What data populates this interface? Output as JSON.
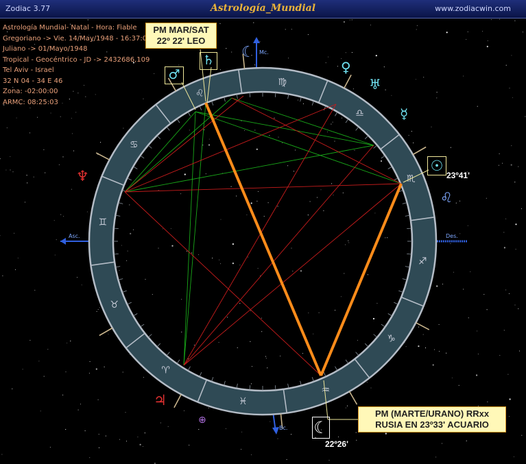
{
  "window": {
    "app_name": "Zodiac 3.77",
    "title": "Astrología_Mundial",
    "url": "www.zodiacwin.com"
  },
  "info_lines": [
    "Astrología Mundial- Natal - Hora: Fiable",
    "Gregoriano -> Vie. 14/May/1948 - 16:37:00",
    "Juliano -> 01/Mayo/1948",
    "Tropical - Geocéntrico - JD -> 2432686,109",
    "Tel Aviv - Israel",
    "32 N 04 - 34 E 46",
    "Zona: -02:00:00",
    "ARMC: 08:25:03"
  ],
  "callouts": {
    "top_line1": "PM MAR/SAT",
    "top_line2": "22º 22' LEO",
    "bottom_line1": "PM (MARTE/URANO) RRxx",
    "bottom_line2": "RUSIA EN 23º33' ACUARIO"
  },
  "labels": {
    "sun_degree": "23º41'",
    "moon_degree": "22º26'",
    "asc": "Asc.",
    "des": "Des.",
    "mc": "Mc.",
    "bc": "Bc."
  },
  "zodiac_signs": [
    "♈",
    "♉",
    "♊",
    "♋",
    "♌",
    "♍",
    "♎",
    "♏",
    "♐",
    "♑",
    "♒",
    "♓"
  ],
  "planets": {
    "sun": "☉",
    "moon": "☾",
    "mercury": "☿",
    "venus": "♀",
    "mars": "♂",
    "jupiter": "♃",
    "saturn": "♄",
    "uranus": "♅",
    "neptune": "♆",
    "node": "☊",
    "fortune": "⊕",
    "leo_outer": "♌"
  },
  "colors": {
    "title_gold": "#e8b23a",
    "ring": "#2f4a55",
    "planet_blue": "#7fa8ff",
    "planet_cyan": "#6fe0f0",
    "planet_red": "#e03030",
    "axis_blue": "#3060e0",
    "highlight_orange": "#ff8c1a",
    "callout_bg": "#fff8b8"
  }
}
